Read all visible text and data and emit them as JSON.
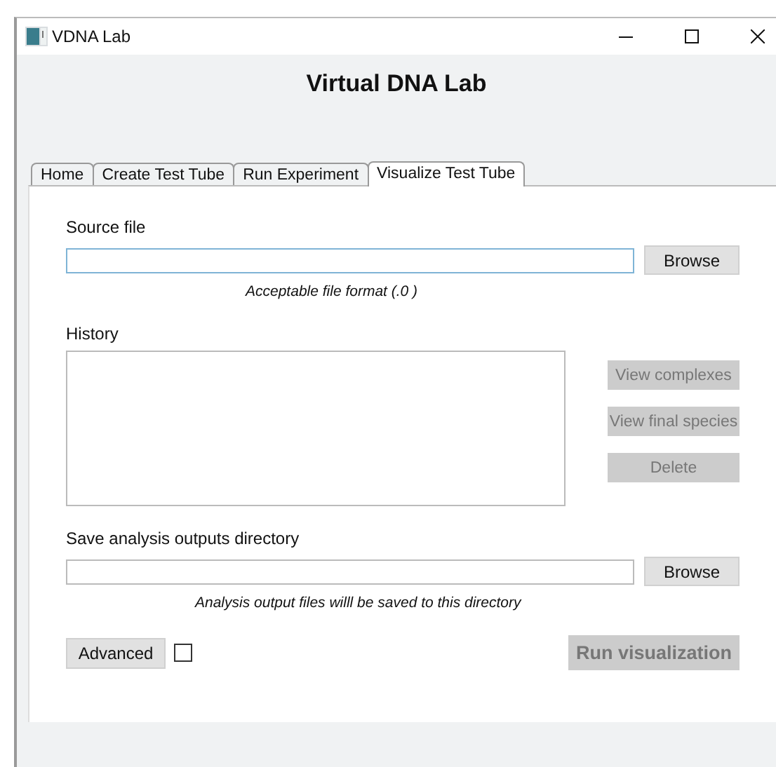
{
  "window": {
    "title": "VDNA Lab"
  },
  "heading": "Virtual DNA Lab",
  "tabs": [
    {
      "label": "Home",
      "selected": false
    },
    {
      "label": "Create Test Tube",
      "selected": false
    },
    {
      "label": "Run Experiment",
      "selected": false
    },
    {
      "label": "Visualize Test Tube",
      "selected": true
    }
  ],
  "source": {
    "label": "Source file",
    "focused": true,
    "button": "Browse",
    "hint": "Acceptable file format (.0 )"
  },
  "history": {
    "label": "History",
    "buttons": [
      {
        "label": "View complexes",
        "disabled": true
      },
      {
        "label": "View final species",
        "disabled": true
      },
      {
        "label": "Delete",
        "disabled": true
      }
    ]
  },
  "output": {
    "label": "Save analysis outputs directory",
    "focused": false,
    "button": "Browse",
    "hint": "Analysis output files willl be saved to this directory"
  },
  "advanced": {
    "label": "Advanced",
    "checked": false
  },
  "run": {
    "label": "Run visualization",
    "disabled": true
  }
}
